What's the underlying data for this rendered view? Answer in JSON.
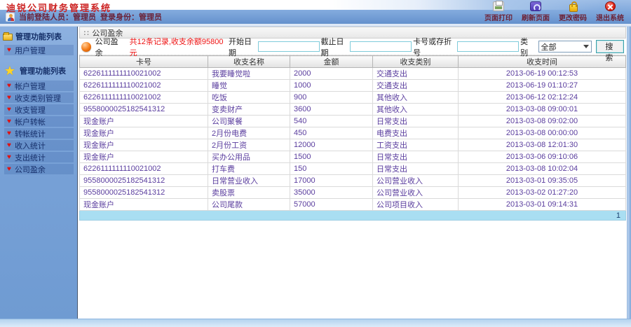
{
  "window": {
    "title": "迪锐公司财务管理系统"
  },
  "header": {
    "user_bar": {
      "current_user_label": "当前登陆人员：管理员",
      "role_label": "登录身份：管理员"
    },
    "actions": [
      {
        "name": "print",
        "icon": "printer-icon",
        "label": "页面打印"
      },
      {
        "name": "refresh",
        "icon": "refresh-icon",
        "label": "刷新页面"
      },
      {
        "name": "password",
        "icon": "lock-icon",
        "label": "更改密码"
      },
      {
        "name": "exit",
        "icon": "exit-icon",
        "label": "退出系统"
      }
    ]
  },
  "sidebar": {
    "groups": [
      {
        "header": {
          "label": "管理功能列表",
          "icon": "folder-icon"
        },
        "items": [
          {
            "label": "用户管理"
          }
        ]
      },
      {
        "header": {
          "label": "管理功能列表",
          "icon": "star-icon"
        },
        "items": [
          {
            "label": "帐户管理"
          },
          {
            "label": "收支类别管理"
          },
          {
            "label": "收支管理"
          },
          {
            "label": "帐户转帐"
          },
          {
            "label": "转帐统计"
          },
          {
            "label": "收入统计"
          },
          {
            "label": "支出统计"
          },
          {
            "label": "公司盈余"
          }
        ]
      }
    ]
  },
  "main": {
    "breadcrumb": {
      "prefix": "::",
      "label": "公司盈余"
    },
    "summary": {
      "icon": "orange-ball-icon",
      "title": "公司盈余",
      "stats": "共12条记录,收支余额95800元"
    },
    "filters": {
      "fields": [
        {
          "name": "start-date",
          "label": "开始日期",
          "value": ""
        },
        {
          "name": "end-date",
          "label": "截止日期",
          "value": ""
        },
        {
          "name": "card-number",
          "label": "卡号或存折号",
          "value": ""
        }
      ],
      "category": {
        "label": "类别",
        "value": "全部"
      },
      "search_button": "搜 索"
    },
    "table": {
      "columns": [
        "卡号",
        "收支名称",
        "金额",
        "收支类别",
        "收支时间"
      ],
      "rows": [
        [
          "6226111111110021002",
          "我要睡觉啦",
          "2000",
          "交通支出",
          "2013-06-19 00:12:53"
        ],
        [
          "6226111111110021002",
          "睡觉",
          "1000",
          "交通支出",
          "2013-06-19 01:10:27"
        ],
        [
          "6226111111110021002",
          "吃饭",
          "900",
          "其他收入",
          "2013-06-12 02:12:24"
        ],
        [
          "9558000025182541312",
          "变卖财产",
          "3600",
          "其他收入",
          "2013-03-08 09:00:01"
        ],
        [
          "现金账户",
          "公司聚餐",
          "540",
          "日常支出",
          "2013-03-08 09:02:00"
        ],
        [
          "现金账户",
          "2月份电费",
          "450",
          "电费支出",
          "2013-03-08 00:00:00"
        ],
        [
          "现金账户",
          "2月份工资",
          "12000",
          "工资支出",
          "2013-03-08 12:01:30"
        ],
        [
          "现金账户",
          "买办公用品",
          "1500",
          "日常支出",
          "2013-03-06 09:10:06"
        ],
        [
          "6226111111110021002",
          "打车费",
          "150",
          "日常支出",
          "2013-03-08 10:02:04"
        ],
        [
          "9558000025182541312",
          "日常营业收入",
          "17000",
          "公司营业收入",
          "2013-03-01 09:35:05"
        ],
        [
          "9558000025182541312",
          "卖股票",
          "35000",
          "公司营业收入",
          "2013-03-02 01:27:20"
        ],
        [
          "现金账户",
          "公司尾款",
          "57000",
          "公司项目收入",
          "2013-03-01 09:14:31"
        ]
      ]
    },
    "pagination": {
      "page": "1"
    }
  },
  "colors": {
    "title_red": "#cc2222",
    "stats_red": "#ee1111",
    "cell_purple": "#5a3d9e",
    "sidebar_blue": "#7aa3d8",
    "pagination_cyan": "#a9def2"
  }
}
